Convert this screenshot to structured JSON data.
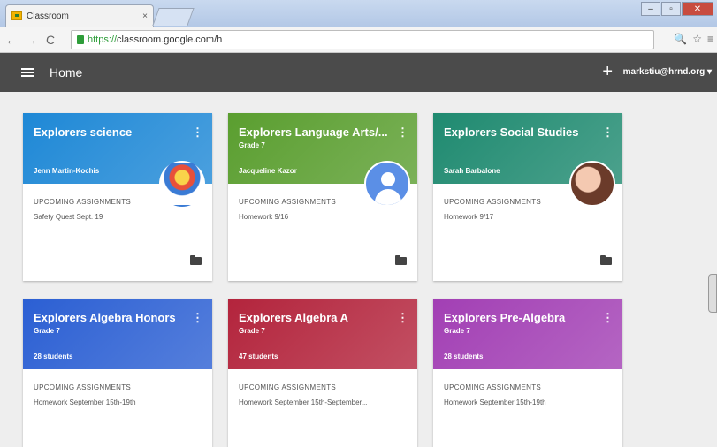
{
  "browser": {
    "tab_title": "Classroom",
    "tab_close": "×",
    "url_scheme": "https://",
    "url_rest": "classroom.google.com/h",
    "toolbar_icons": [
      "zoom-icon",
      "star-icon",
      "menu-icon"
    ]
  },
  "appbar": {
    "title": "Home",
    "plus": "+",
    "account": "markstiu@hrnd.org ▾"
  },
  "kebab_glyph": "⋮",
  "courses": [
    {
      "title": "Explorers science",
      "subtitle": "",
      "bottom": "Jenn Martin-Kochis",
      "upcoming_label": "UPCOMING ASSIGNMENTS",
      "assignment": "Safety Quest Sept. 19",
      "color": "#1e88d6",
      "avatar": "cartoon"
    },
    {
      "title": "Explorers Language Arts/...",
      "subtitle": "Grade 7",
      "bottom": "Jacqueline Kazor",
      "upcoming_label": "UPCOMING ASSIGNMENTS",
      "assignment": "Homework 9/16",
      "color": "#5a9e2f",
      "avatar": "generic"
    },
    {
      "title": "Explorers Social Studies",
      "subtitle": "",
      "bottom": "Sarah Barbalone",
      "upcoming_label": "UPCOMING ASSIGNMENTS",
      "assignment": "Homework 9/17",
      "color": "#1f8a70",
      "avatar": "photo"
    },
    {
      "title": "Explorers Algebra Honors",
      "subtitle": "Grade 7",
      "bottom": "28 students",
      "upcoming_label": "UPCOMING ASSIGNMENTS",
      "assignment": "Homework September 15th-19th",
      "color": "#2b5fd3",
      "avatar": ""
    },
    {
      "title": "Explorers Algebra A",
      "subtitle": "Grade 7",
      "bottom": "47 students",
      "upcoming_label": "UPCOMING ASSIGNMENTS",
      "assignment": "Homework September 15th-September...",
      "color": "#b3243c",
      "avatar": ""
    },
    {
      "title": "Explorers Pre-Algebra",
      "subtitle": "Grade 7",
      "bottom": "28 students",
      "upcoming_label": "UPCOMING ASSIGNMENTS",
      "assignment": "Homework September 15th-19th",
      "color": "#a23fb4",
      "avatar": ""
    }
  ]
}
